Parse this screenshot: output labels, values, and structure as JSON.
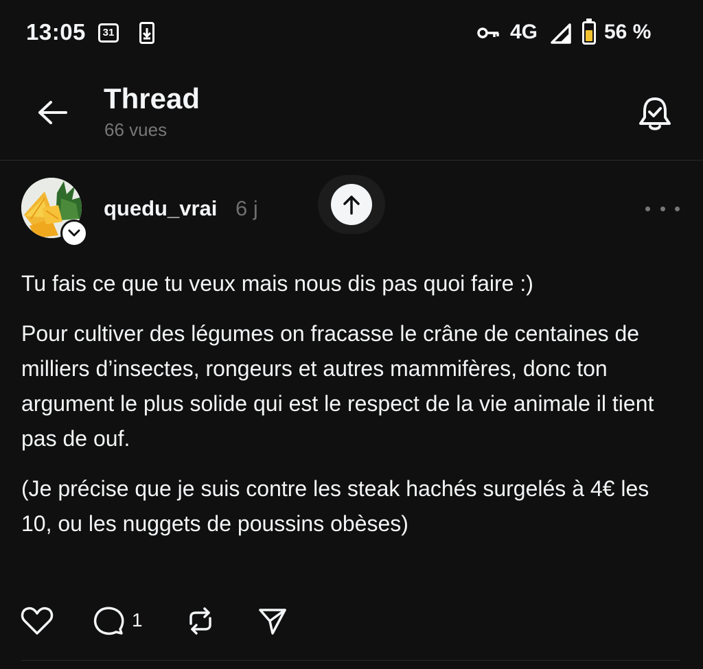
{
  "status_bar": {
    "time": "13:05",
    "calendar_day": "31",
    "network": "4G",
    "battery": "56 %",
    "battery_level": 0.56,
    "icons": [
      "calendar-icon",
      "download-icon",
      "vpn-key-icon",
      "signal-icon",
      "battery-icon"
    ]
  },
  "header": {
    "title": "Thread",
    "views": "66 vues",
    "icons": [
      "back-arrow-icon",
      "notification-bell-icon"
    ]
  },
  "post": {
    "username": "quedu_vrai",
    "time": "6 j",
    "paragraphs": [
      "Tu fais ce que tu veux mais nous dis pas quoi faire :)",
      "Pour cultiver des légumes on fracasse le crâne de centaines de milliers d’insectes, rongeurs et autres mammifères, donc ton argument le plus solide qui est le respect de la vie animale il tient pas de ouf.",
      "(Je précise que je suis contre les steak hachés surgelés à 4€ les 10, ou les nuggets de poussins obèses)"
    ],
    "reply_count": "1",
    "icons": [
      "like-icon",
      "reply-icon",
      "repost-icon",
      "share-icon",
      "more-icon",
      "scroll-top-icon"
    ]
  },
  "colors": {
    "background": "#101010",
    "text": "#f3f5f7",
    "muted": "#777777",
    "battery_fill": "#f2c230"
  }
}
